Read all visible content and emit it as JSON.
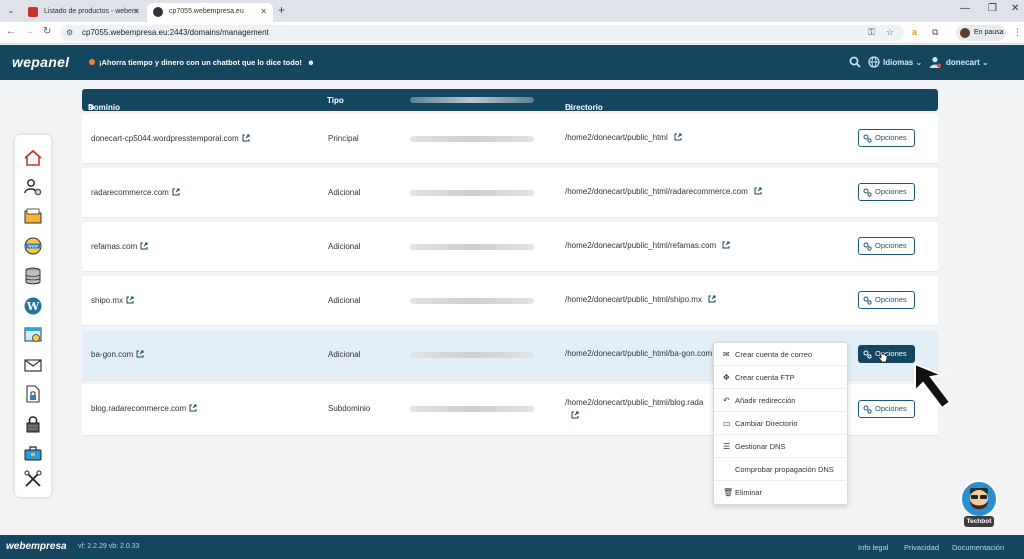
{
  "browser": {
    "tabs": [
      {
        "title": "Listado de productos - webem"
      },
      {
        "title": "cp7055.webempresa.eu"
      }
    ],
    "url": "cp7055.webempresa.eu:2443/domains/management",
    "profile_status": "En pausa"
  },
  "header": {
    "logo": "wepanel",
    "promo": "¡Ahorra tiempo y dinero con un chatbot que lo dice todo!",
    "language_label": "Idiomas",
    "user_label": "donecart"
  },
  "sidebar": {
    "items": [
      {
        "icon": "home-icon"
      },
      {
        "icon": "user-settings-icon"
      },
      {
        "icon": "folder-icon"
      },
      {
        "icon": "globe-www-icon"
      },
      {
        "icon": "database-icon"
      },
      {
        "icon": "wordpress-icon"
      },
      {
        "icon": "website-icon"
      },
      {
        "icon": "mail-icon"
      },
      {
        "icon": "file-lock-icon"
      },
      {
        "icon": "lock-icon"
      },
      {
        "icon": "toolbox-icon"
      },
      {
        "icon": "tools-icon"
      }
    ]
  },
  "table": {
    "headers": {
      "domain": "Dominio",
      "type": "Tipo",
      "directory": "Directorio"
    },
    "option_label": "Opciones",
    "rows": [
      {
        "domain": "donecart-cp5044.wordpresstemporal.com",
        "type": "Principal",
        "directory": "/home2/donecart/public_html"
      },
      {
        "domain": "radarecommerce.com",
        "type": "Adicional",
        "directory": "/home2/donecart/public_html/radarecommerce.com"
      },
      {
        "domain": "refamas.com",
        "type": "Adicional",
        "directory": "/home2/donecart/public_html/refamas.com"
      },
      {
        "domain": "shipo.mx",
        "type": "Adicional",
        "directory": "/home2/donecart/public_html/shipo.mx"
      },
      {
        "domain": "ba-gon.com",
        "type": "Adicional",
        "directory": "/home2/donecart/public_html/ba-gon.com"
      },
      {
        "domain": "blog.radarecommerce.com",
        "type": "Subdominio",
        "directory": "/home2/donecart/public_html/blog.rada"
      }
    ]
  },
  "dropdown": {
    "items": [
      {
        "label": "Crear cuenta de correo",
        "icon": "mail-icon"
      },
      {
        "label": "Crear cuenta FTP",
        "icon": "arrows-icon"
      },
      {
        "label": "Añadir redirección",
        "icon": "redirect-icon"
      },
      {
        "label": "Cambiar Directorio",
        "icon": "folder-icon"
      },
      {
        "label": "Gestionar DNS",
        "icon": "list-icon"
      },
      {
        "label": "Comprobar propagación DNS",
        "icon": ""
      },
      {
        "label": "Eliminar",
        "icon": "trash-icon"
      }
    ]
  },
  "chatbot": {
    "label": "Techbot"
  },
  "footer": {
    "logo": "webempresa",
    "version": "vf: 2.2.29  vb: 2.0.33",
    "links": [
      "Info legal",
      "Privacidad",
      "Documentación"
    ]
  },
  "colors": {
    "primary": "#15465f",
    "accent": "#f0803c",
    "highlight": "#e2eef7"
  }
}
